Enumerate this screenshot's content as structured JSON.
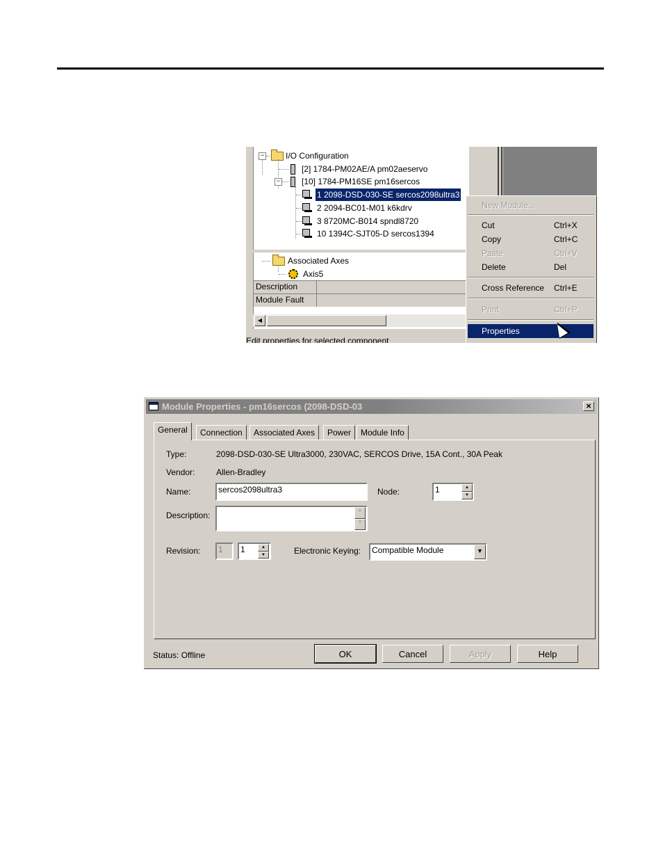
{
  "tree": {
    "partial_above": "...",
    "io_configuration": "I/O Configuration",
    "module_2": "[2] 1784-PM02AE/A pm02aeservo",
    "module_10": "[10] 1784-PM16SE pm16sercos",
    "drives": [
      "1 2098-DSD-030-SE sercos2098ultra3",
      "2 2094-BC01-M01 k6kdrv",
      "3 8720MC-B014 spndl8720",
      "10 1394C-SJT05-D sercos1394"
    ],
    "associated_axes": "Associated Axes",
    "axis": "Axis5",
    "grid_description": "Description",
    "grid_module_fault": "Module Fault",
    "status_text": "Edit properties for selected component"
  },
  "context_menu": {
    "new_module": "New Module...",
    "cut": "Cut",
    "cut_key": "Ctrl+X",
    "copy": "Copy",
    "copy_key": "Ctrl+C",
    "paste": "Paste",
    "paste_key": "Ctrl+V",
    "delete": "Delete",
    "delete_key": "Del",
    "cross_reference": "Cross Reference",
    "cross_reference_key": "Ctrl+E",
    "print": "Print",
    "print_key": "Ctrl+P",
    "properties": "Properties"
  },
  "dialog": {
    "title": "Module Properties - pm16sercos (2098-DSD-03",
    "close": "×",
    "tabs": [
      "General",
      "Connection",
      "Associated Axes",
      "Power",
      "Module Info"
    ],
    "type_label": "Type:",
    "type_value": "2098-DSD-030-SE Ultra3000, 230VAC, SERCOS Drive, 15A Cont., 30A Peak",
    "vendor_label": "Vendor:",
    "vendor_value": "Allen-Bradley",
    "name_label": "Name:",
    "name_value": "sercos2098ultra3",
    "node_label": "Node:",
    "node_value": "1",
    "description_label": "Description:",
    "description_value": "",
    "revision_label": "Revision:",
    "revision_major": "1",
    "revision_minor": "1",
    "keying_label": "Electronic Keying:",
    "keying_value": "Compatible Module",
    "status": "Status:  Offline",
    "ok": "OK",
    "cancel": "Cancel",
    "apply": "Apply",
    "help": "Help"
  }
}
